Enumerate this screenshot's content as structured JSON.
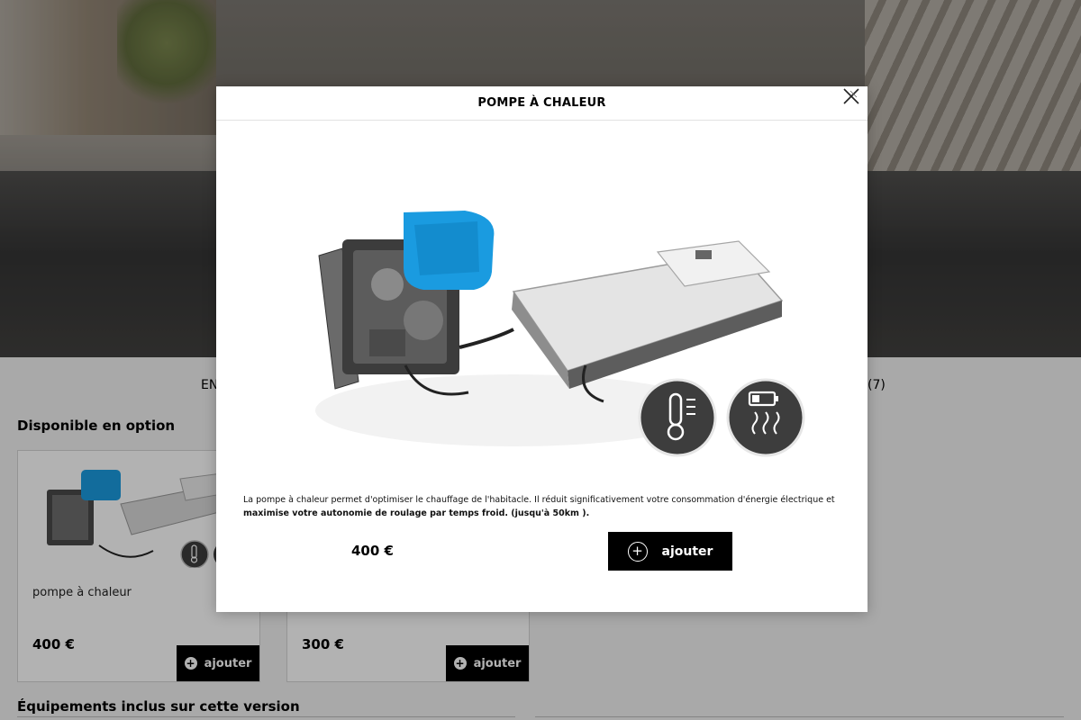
{
  "background": {
    "tabs": {
      "left_partial": "EN",
      "right_partial": "(7)"
    },
    "optional_section_title": "Disponible en option",
    "included_section_title": "Équipements inclus sur cette version",
    "cards": [
      {
        "name": "pompe à chaleur",
        "price": "400 €",
        "button_label": "ajouter"
      },
      {
        "name": "",
        "price": "300 €",
        "button_label": "ajouter"
      }
    ]
  },
  "modal": {
    "title": "POMPE À CHALEUR",
    "description_part1": "La pompe à chaleur permet d'optimiser le chauffage de l'habitacle. Il réduit significativement votre consommation d'énergie électrique et ",
    "description_bold": "maximise votre autonomie de roulage par temps froid. (jusqu'à 50km ).",
    "price": "400 €",
    "add_label": "ajouter",
    "icons": [
      "thermometer-icon",
      "battery-heating-icon"
    ]
  },
  "colors": {
    "accent": "#000000",
    "heat_pump_blue": "#1a9be0"
  }
}
